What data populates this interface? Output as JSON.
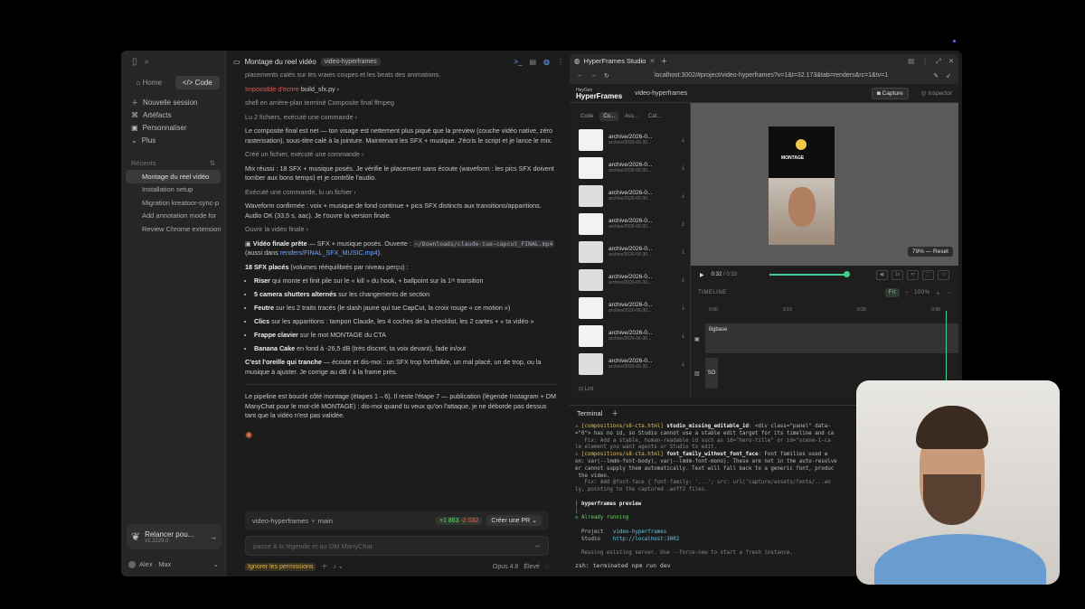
{
  "sidebar": {
    "home_label": "Home",
    "code_label": "Code",
    "nav": [
      "Nouvelle session",
      "Artéfacts",
      "Personnaliser",
      "Plus"
    ],
    "recents_label": "Récents",
    "recents": [
      "Montage du reel vidéo",
      "Installation setup",
      "Migration kreatoor-sync-p",
      "Add annotation mode for",
      "Review Chrome extension"
    ],
    "relaunch_title": "Relancer pou...",
    "relaunch_version": "v1.2229.0",
    "user_name": "Alex · Max"
  },
  "chat": {
    "title": "Montage du reel vidéo",
    "tag": "video-hyperframes",
    "line0": "placements calés sur les vraies coupes et les beats des animations.",
    "error_label": "Impossible d'écrire",
    "error_file": "build_sfx.py",
    "shell_note": "shell en arrière-plan terminé Composite final ffmpeg",
    "read_note": "Lu 2 fichiers, exécuté une commande",
    "p1": "Le composite final est net — ton visage est nettement plus piqué que la preview (couche vidéo native, zéro rasterisation), sous-titre calé à la jointure. Maintenant les SFX + musique. J'écris le script et je lance le mix.",
    "create_note": "Créé un fichier, exécuté une commande",
    "p2": "Mix réussi : 18 SFX + musique posés. Je vérifie le placement sans écoute (waveform : les pics SFX doivent tomber aux bons temps) et je contrôle l'audio.",
    "exec_note": "Exécuté une commande, lu un fichier",
    "p3": "Waveform confirmée : voix + musique de fond continue + pics SFX distincts aux transitions/apparitions. Audio OK (33,5 s, aac). Je t'ouvre la version finale.",
    "open_note": "Ouvrir la vidéo finale",
    "final_title": "Vidéo finale prête",
    "final_text": " — SFX + musique posés. Ouverte : ",
    "final_path": "~/Downloads/claude-tue-capcut_FINAL.mp4",
    "final_also": " (aussi dans ",
    "final_link": "renders/FINAL_SFX_MUSIC.mp4",
    "final_end": ").",
    "sfx_title": "18 SFX placés",
    "sfx_sub": " (volumes rééquilibrés par niveau perçu) :",
    "bullets": [
      {
        "b": "Riser",
        "t": " qui monte et finit pile sur le « kill » du hook, + ballpoint sur la 1ʳᵉ transition"
      },
      {
        "b": "5 camera shutters alternés",
        "t": " sur les changements de section"
      },
      {
        "b": "Feutre",
        "t": " sur les 2 traits tracés (le slash jaune qui tue CapCut, la croix rouge « ce motion »)"
      },
      {
        "b": "Clics",
        "t": " sur les apparitions : tampon Claude, les 4 coches de la checklist, les 2 cartes + « ta vidéo »"
      },
      {
        "b": "Frappe clavier",
        "t": " sur le mot MONTAGE du CTA"
      },
      {
        "b": "Banana Cake",
        "t": " en fond à -26,5 dB (très discret, ta voix devant), fade in/out"
      }
    ],
    "ear_bold": "C'est l'oreille qui tranche",
    "ear_text": " — écoute et dis-moi : un SFX trop fort/faible, un mal placé, un de trop, ou la musique à ajuster. Je corrige au dB / à la frame près.",
    "pipeline": "Le pipeline est bouclé côté montage (étapes 1→6). Il reste l'étape 7 — publication (légende Instagram + DM ManyChat pour le mot-clé MONTAGE) : dis-moi quand tu veux qu'on l'attaque, je ne déborde pas dessus tant que la vidéo n'est pas validée.",
    "branch_repo": "video-hyperframes",
    "branch_name": "main",
    "added": "+1 863",
    "removed": "-2 032",
    "pr_label": "Créer une PR",
    "input_placeholder": "passe à la légende et au DM ManyChat",
    "perm_label": "Ignorer les permissions",
    "model": "Opus 4.8",
    "effort": "Élevé"
  },
  "browser": {
    "tab_title": "HyperFrames Studio",
    "url": "localhost:3002/#project/video-hyperframes?v=1&t=32.173&tab=renders&rc=1&tv=1",
    "brand_top": "HeyGen",
    "brand": "HyperFrames",
    "project": "video-hyperframes",
    "capture": "Capture",
    "inspector": "Inspector",
    "chips": [
      "Code",
      "Co...",
      "Ass...",
      "Cat..."
    ],
    "archive_name": "archive/2026-0...",
    "archive_sub": "archive/2026-06-30...",
    "lint": "Lint",
    "montage_label": "MONTAGE",
    "zoom_label": "79% — Reset",
    "time_current": "0:32",
    "time_total": "0:33",
    "speed": "1x",
    "timeline_label": "TIMELINE",
    "fit_label": "Fit",
    "zoom_pct": "100%",
    "ticks": [
      "0:00",
      "0:10",
      "0:20",
      "0:30"
    ],
    "clip1": "Bgbase",
    "clip2": "SO"
  },
  "terminal": {
    "tab": "Terminal",
    "warn1": "⚠ [compositions/s8-cta.html] ",
    "warn1_b": "studio_missing_editable_id",
    "warn1_t": ": <div class=\"panel\" data-",
    "l2": "=\"0\"> has no id, so Studio cannot use a stable edit target for its timeline and ca",
    "l3": "   Fix: Add a stable, human-readable id such as id=\"hero-title\" or id=\"scene-1-ca",
    "l4": "le element you want agents or Studio to edit.",
    "warn2": "⚠ [compositions/s8-cta.html] ",
    "warn2_b": "font_family_without_font_face",
    "warn2_t": ": Font families used w",
    "l6": "on: var(--lmdm-font-body), var(--lmdm-font-mono). These are not in the auto-resolve",
    "l7": "er cannot supply them automatically. Text will fall back to a generic font, produc",
    "l8": " the video.",
    "l9": "   Fix: Add @font-face { font-family: '...'; src: url('capture/assets/fonts/...wo",
    "l10": "ly, pointing to the captured .woff2 files.",
    "preview_title": "hyperframes preview",
    "running": "Already running",
    "project_label": "Project",
    "project_val": "video-hyperframes",
    "studio_label": "Studio",
    "studio_val": "http://localhost:3002",
    "reuse": "Reusing existing server. Use --force-new to start a fresh instance.",
    "prompt": "zsh: terminated  npm run dev"
  }
}
